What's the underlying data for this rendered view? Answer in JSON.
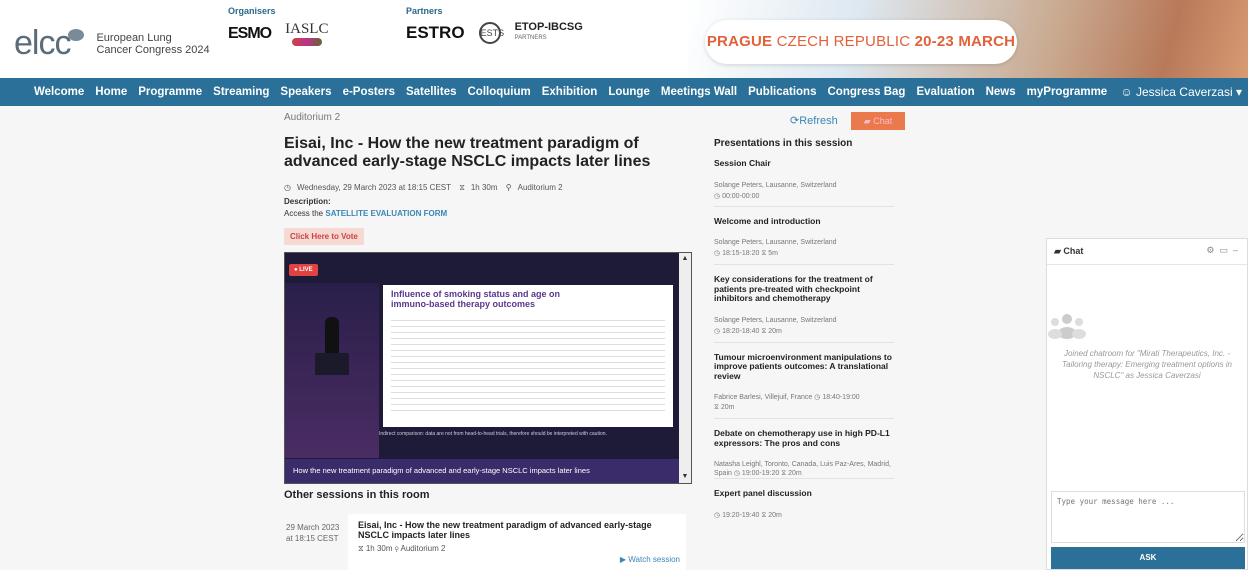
{
  "header": {
    "logo_word": "elcc",
    "logo_sub_1": "European Lung",
    "logo_sub_2": "Cancer Congress 2024",
    "organisers_label": "Organisers",
    "organisers": [
      "ESMO",
      "IASLC"
    ],
    "partners_label": "Partners",
    "partners": [
      "ESTRO",
      "ESTS",
      "ETOP-IBCSG"
    ],
    "etop_sub": "PARTNERS",
    "banner_city": "PRAGUE",
    "banner_country": " CZECH REPUBLIC ",
    "banner_dates": "20-23 MARCH 2024"
  },
  "nav": {
    "items": [
      "Welcome",
      "Home",
      "Programme",
      "Streaming",
      "Speakers",
      "e-Posters",
      "Satellites",
      "Colloquium",
      "Exhibition",
      "Lounge",
      "Meetings Wall",
      "Publications",
      "Congress Bag",
      "Evaluation",
      "News",
      "myProgramme"
    ],
    "user": "Jessica Caverzasi"
  },
  "main": {
    "auditorium": "Auditorium 2",
    "title": "Eisai, Inc - How the new treatment paradigm of advanced early-stage NSCLC impacts later lines",
    "date": "Wednesday, 29 March 2023 at 18:15 CEST",
    "duration": "1h 30m",
    "location": "Auditorium 2",
    "description_label": "Description:",
    "description_prefix": "Access the ",
    "description_link": "SATELLITE EVALUATION FORM",
    "vote_label": "Click Here to Vote"
  },
  "player": {
    "live": "LIVE",
    "slide_title": "Influence of smoking status and age on immuno-based therapy outcomes",
    "caption": "Indirect comparison: data are not from head-to-head trials, therefore should be interpreted with caution.",
    "footer": "How the new treatment paradigm of advanced and early-stage NSCLC impacts later lines"
  },
  "other": {
    "title": "Other sessions in this room",
    "session": {
      "date": "29 March 2023 at 18:15 CEST",
      "title": "Eisai, Inc - How the new treatment paradigm of advanced early-stage NSCLC impacts later lines",
      "duration": "1h 30m",
      "location": "Auditorium 2",
      "watch": "Watch session"
    }
  },
  "sidebar": {
    "refresh": "Refresh",
    "chat_tab": "Chat",
    "heading": "Presentations in this session",
    "items": [
      {
        "title": "Session Chair",
        "who": "Solange Peters, Lausanne, Switzerland",
        "time": "00:00-00:00",
        "dur": ""
      },
      {
        "title": "Welcome and introduction",
        "who": "Solange Peters, Lausanne, Switzerland",
        "time": "18:15-18:20",
        "dur": "5m"
      },
      {
        "title": "Key considerations for the treatment of patients pre-treated with checkpoint inhibitors and chemotherapy",
        "who": "Solange Peters, Lausanne, Switzerland",
        "time": "18:20-18:40",
        "dur": "20m"
      },
      {
        "title": "Tumour microenvironment manipulations to improve patients outcomes: A translational review",
        "who": "Fabrice Barlesi, Villejuif, France",
        "time": "18:40-19:00",
        "dur": "20m"
      },
      {
        "title": "Debate on chemotherapy use in high PD-L1 expressors: The pros and cons",
        "who": "Natasha Leighl, Toronto, Canada, Luis Paz-Ares, Madrid, Spain",
        "time": "19:00-19:20",
        "dur": "20m"
      },
      {
        "title": "Expert panel discussion",
        "who": "",
        "time": "19:20-19:40",
        "dur": "20m"
      }
    ]
  },
  "chat": {
    "title": "Chat",
    "message": "Joined chatroom for \"Mirati Therapeutics, Inc. - Tailoring therapy: Emerging treatment options in NSCLC\" as Jessica Caverzasi",
    "placeholder": "Type your message here ...",
    "ask": "ASK"
  }
}
